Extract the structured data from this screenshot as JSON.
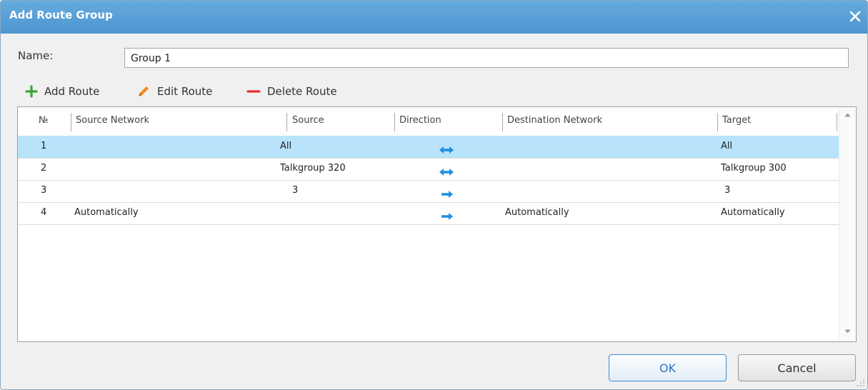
{
  "dialog": {
    "title": "Add Route Group",
    "close_icon": "close-icon"
  },
  "name": {
    "label": "Name:",
    "value": "Group 1"
  },
  "toolbar": {
    "add_label": "Add Route",
    "edit_label": "Edit Route",
    "delete_label": "Delete Route"
  },
  "table": {
    "headers": {
      "num": "№",
      "source_network": "Source Network",
      "source": "Source",
      "direction": "Direction",
      "destination_network": "Destination Network",
      "target": "Target"
    },
    "rows": [
      {
        "num": "1",
        "source_network": "",
        "source": "All",
        "direction": "bidirectional",
        "destination_network": "",
        "target": "All",
        "selected": true
      },
      {
        "num": "2",
        "source_network": "",
        "source": "Talkgroup 320",
        "direction": "bidirectional",
        "destination_network": "",
        "target": "Talkgroup 300",
        "selected": false
      },
      {
        "num": "3",
        "source_network": "",
        "source": "3",
        "direction": "forward",
        "destination_network": "",
        "target": "3",
        "selected": false
      },
      {
        "num": "4",
        "source_network": "Automatically",
        "source": "",
        "direction": "forward",
        "destination_network": "Automatically",
        "target": "Automatically",
        "selected": false
      }
    ]
  },
  "buttons": {
    "ok": "OK",
    "cancel": "Cancel"
  },
  "colors": {
    "titlebar": "#4d95cf",
    "selection": "#b8e3fb",
    "direction_arrow": "#1f8fe0",
    "add_icon": "#3aa535",
    "edit_icon": "#f08a1c",
    "delete_icon": "#e0352b"
  }
}
